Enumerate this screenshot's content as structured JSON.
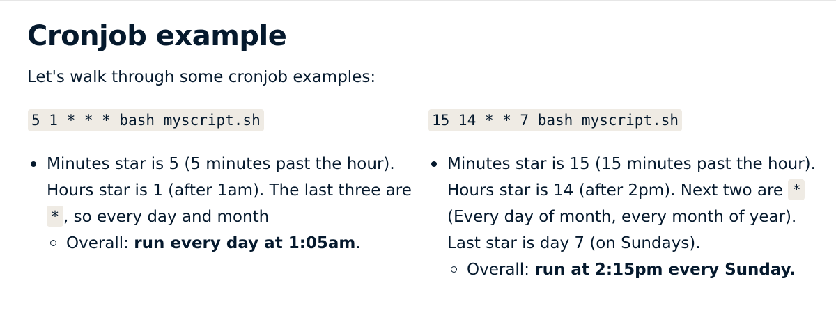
{
  "title": "Cronjob example",
  "intro": "Let's walk through some cronjob examples:",
  "examples": [
    {
      "code": "5 1 * * * bash myscript.sh",
      "bullet_before": "Minutes star is 5 (5 minutes past the hour). Hours star is 1 (after 1am). The last three are",
      "bullet_code": "*",
      "bullet_after": ", so every day and month",
      "overall_label": "Overall:",
      "overall_value": "run every day at 1:05am",
      "overall_tail": "."
    },
    {
      "code": "15 14 * * 7 bash myscript.sh",
      "bullet_before": "Minutes star is 15 (15 minutes past the hour). Hours star is 14 (after 2pm). Next two are",
      "bullet_code": "*",
      "bullet_after": "(Every day of month, every month of year). Last star is day 7 (on Sundays).",
      "overall_label": "Overall:",
      "overall_value": "run at 2:15pm every Sunday.",
      "overall_tail": ""
    }
  ],
  "colors": {
    "text": "#05192d",
    "code_background": "#efebe4"
  },
  "icons": {
    "bullet": "filled-disc-bullet-icon",
    "sub_bullet": "hollow-circle-bullet-icon"
  }
}
